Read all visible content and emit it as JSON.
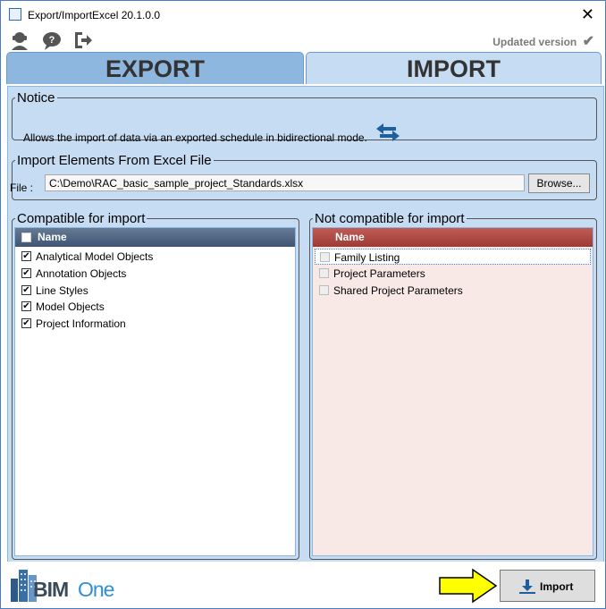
{
  "window": {
    "title": "Export/ImportExcel 20.1.0.0",
    "close_symbol": "✕"
  },
  "toolbar": {
    "icons": [
      "support-agent-icon",
      "help-chat-icon",
      "exit-icon"
    ],
    "updated_label": "Updated version",
    "checkmark": "✔"
  },
  "tabs": [
    {
      "label": "EXPORT",
      "selected": false
    },
    {
      "label": "IMPORT",
      "selected": true
    }
  ],
  "notice": {
    "legend": "Notice",
    "text": "Allows the import of data via an exported schedule in bidirectional mode."
  },
  "import_file": {
    "legend": "Import Elements From Excel File",
    "file_label": "File :",
    "file_value": "C:\\Demo\\RAC_basic_sample_project_Standards.xlsx",
    "browse_label": "Browse..."
  },
  "compatible": {
    "legend": "Compatible for import",
    "header": "Name",
    "items": [
      {
        "label": "Analytical Model Objects",
        "checked": true
      },
      {
        "label": "Annotation Objects",
        "checked": true
      },
      {
        "label": "Line Styles",
        "checked": true
      },
      {
        "label": "Model Objects",
        "checked": true
      },
      {
        "label": "Project Information",
        "checked": true
      }
    ]
  },
  "not_compatible": {
    "legend": "Not compatible for import",
    "header": "Name",
    "items": [
      {
        "label": "Family Listing",
        "checked": false,
        "focused": true
      },
      {
        "label": "Project Parameters",
        "checked": false
      },
      {
        "label": "Shared Project Parameters",
        "checked": false
      }
    ]
  },
  "footer": {
    "logo_text_bim": "BIM",
    "logo_text_one": "One",
    "import_label": "Import"
  },
  "colors": {
    "accent_blue": "#8db7df",
    "panel_blue": "#c6dcf3",
    "header_red": "#9c3b36",
    "header_slate": "#3f5572",
    "arrow_yellow": "#ffff00"
  }
}
